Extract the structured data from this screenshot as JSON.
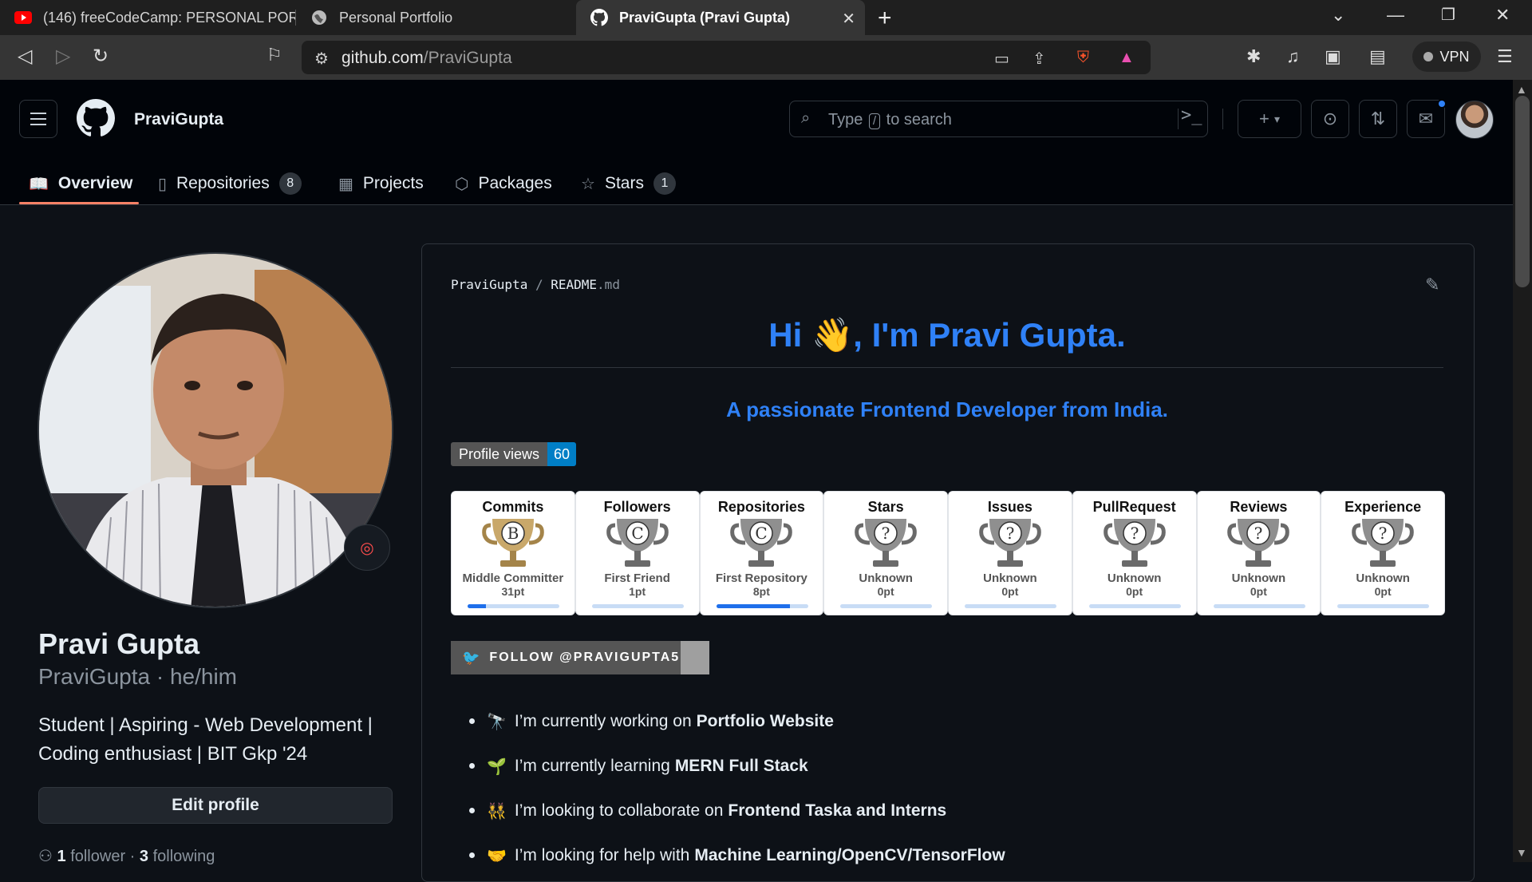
{
  "browser": {
    "tabs": [
      {
        "title": "(146) freeCodeCamp: PERSONAL POR",
        "icon": "youtube-icon"
      },
      {
        "title": "Personal Portfolio",
        "icon": "globe-icon"
      },
      {
        "title": "PraviGupta (Pravi Gupta)",
        "icon": "github-icon"
      }
    ],
    "url_host": "github.com",
    "url_path": "/PraviGupta",
    "vpn_label": "VPN"
  },
  "header": {
    "username": "PraviGupta",
    "search_prefix": "Type",
    "search_key": "/",
    "search_suffix": "to search"
  },
  "nav": {
    "overview": "Overview",
    "repositories": "Repositories",
    "repositories_count": "8",
    "projects": "Projects",
    "packages": "Packages",
    "stars": "Stars",
    "stars_count": "1"
  },
  "profile": {
    "name": "Pravi Gupta",
    "login_line": "PraviGupta · he/him",
    "bio": "Student | Aspiring - Web Development | Coding enthusiast | BIT Gkp '24",
    "edit_label": "Edit profile",
    "followers_count": "1",
    "followers_label": "follower",
    "following_sep": "·",
    "following_count": "3",
    "following_label": "following"
  },
  "readme": {
    "path_owner": "PraviGupta",
    "path_sep": "/",
    "path_file": "README",
    "path_ext": ".md",
    "title": "Hi 👋, I'm Pravi Gupta.",
    "subtitle": "A passionate Frontend Developer from India.",
    "profile_views_label": "Profile views",
    "profile_views_count": "60",
    "twitter_label": "FOLLOW @PRAVIGUPTA5",
    "trophies": [
      {
        "title": "Commits",
        "grade": "B",
        "rank": "Middle Committer",
        "points": "31pt",
        "progress": 0.2,
        "cup": "gold"
      },
      {
        "title": "Followers",
        "grade": "C",
        "rank": "First Friend",
        "points": "1pt",
        "progress": 0.0,
        "cup": "silver"
      },
      {
        "title": "Repositories",
        "grade": "C",
        "rank": "First Repository",
        "points": "8pt",
        "progress": 0.8,
        "cup": "silver"
      },
      {
        "title": "Stars",
        "grade": "?",
        "rank": "Unknown",
        "points": "0pt",
        "progress": 0.0,
        "cup": "silver"
      },
      {
        "title": "Issues",
        "grade": "?",
        "rank": "Unknown",
        "points": "0pt",
        "progress": 0.0,
        "cup": "silver"
      },
      {
        "title": "PullRequest",
        "grade": "?",
        "rank": "Unknown",
        "points": "0pt",
        "progress": 0.0,
        "cup": "silver"
      },
      {
        "title": "Reviews",
        "grade": "?",
        "rank": "Unknown",
        "points": "0pt",
        "progress": 0.0,
        "cup": "silver"
      },
      {
        "title": "Experience",
        "grade": "?",
        "rank": "Unknown",
        "points": "0pt",
        "progress": 0.0,
        "cup": "silver"
      }
    ],
    "bullets": [
      {
        "emoji": "🔭",
        "text": "I’m currently working on",
        "bold": "Portfolio Website"
      },
      {
        "emoji": "🌱",
        "text": "I’m currently learning",
        "bold": "MERN Full Stack"
      },
      {
        "emoji": "👯",
        "text": "I’m looking to collaborate on",
        "bold": "Frontend Taska and Interns"
      },
      {
        "emoji": "🤝",
        "text": "I’m looking for help with",
        "bold": "Machine Learning/OpenCV/TensorFlow"
      }
    ]
  },
  "colors": {
    "accent_blue": "#2f81f7",
    "tab_underline": "#f78166",
    "bg": "#0d1117"
  }
}
